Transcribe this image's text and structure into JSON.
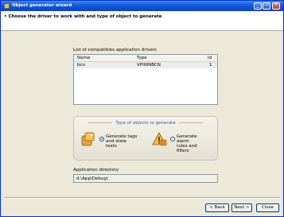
{
  "window": {
    "title": "Object generator wizard",
    "minimize_glyph": "_",
    "restore_glyph": "❐",
    "close_glyph": "✕"
  },
  "header": {
    "instruction": "Choose the driver to work with and type of object to generate"
  },
  "drivers": {
    "label": "List of compatibles application drivers",
    "columns": [
      "Name",
      "Type",
      "Id"
    ],
    "rows": [
      {
        "name": "bcn",
        "type": "VPIWNBCN",
        "id": "1"
      }
    ]
  },
  "types": {
    "title": "Type of objects to generate",
    "options": [
      {
        "label": "Generate tags\nand state texts",
        "checked": true,
        "icon": "tags-icon"
      },
      {
        "label": "Generate alarm\nrules and filters",
        "checked": false,
        "icon": "alarm-icon"
      }
    ]
  },
  "directory": {
    "label": "Application directory",
    "value": "d:\\App\\Debug\\"
  },
  "buttons": {
    "back": "< Back",
    "next": "Next >",
    "close": "Close"
  },
  "colors": {
    "titlebar": "#0a53d8",
    "accent_text": "#3558a8",
    "radio_checked": "#21a121"
  }
}
